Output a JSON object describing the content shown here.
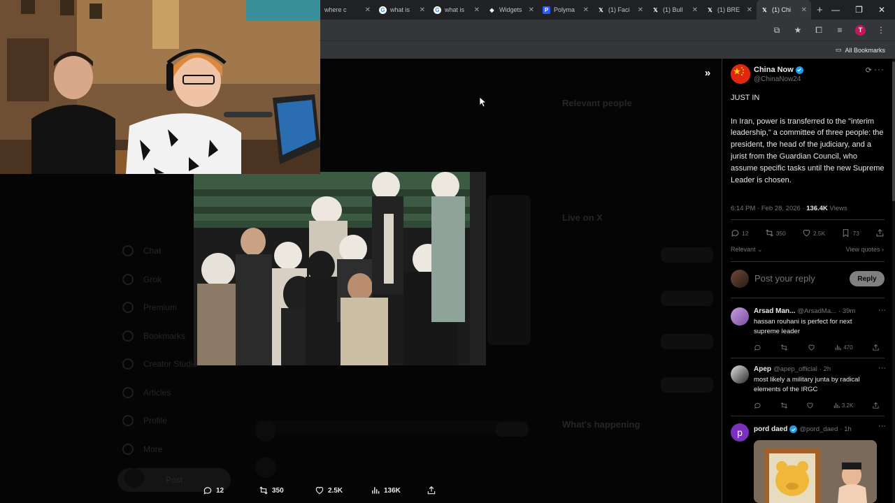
{
  "browser": {
    "tabs": [
      {
        "title": "where c",
        "favicon": "generic",
        "active": false
      },
      {
        "title": "what is",
        "favicon": "google",
        "active": false
      },
      {
        "title": "what is",
        "favicon": "google",
        "active": false
      },
      {
        "title": "Widgets",
        "favicon": "widget",
        "active": false
      },
      {
        "title": "Polyma",
        "favicon": "polymarket",
        "active": false
      },
      {
        "title": "(1) Faci",
        "favicon": "x",
        "active": false
      },
      {
        "title": "(1) Bull",
        "favicon": "x",
        "active": false
      },
      {
        "title": "(1) BRE",
        "favicon": "x",
        "active": false
      },
      {
        "title": "(1) Chi",
        "favicon": "x",
        "active": true
      }
    ],
    "profile_initial": "T",
    "bookmarks_label": "All Bookmarks"
  },
  "post": {
    "author_name": "China Now",
    "author_handle": "@ChinaNow24",
    "text": "JUST IN\n\nIn Iran, power is transferred to the \"interim leadership,\" a committee of three people: the president, the head of the judiciary, and a jurist from the Guardian Council, who assume specific tasks until the new Supreme Leader is chosen.",
    "timestamp": "6:14 PM · Feb 28, 2026 · ",
    "views_count": "136.4K",
    "views_label": "Views",
    "stats": {
      "replies": "12",
      "reposts": "350",
      "likes": "2.5K",
      "bookmarks": "73"
    },
    "sort_label": "Relevant",
    "view_quotes_label": "View quotes"
  },
  "reply_composer": {
    "placeholder": "Post your reply",
    "button_label": "Reply"
  },
  "replies": [
    {
      "name": "Arsad Man...",
      "handle": "@ArsadMa...",
      "time": "· 39m",
      "text": "hassan rouhani is perfect for next supreme leader",
      "views": "470"
    },
    {
      "name": "Apep",
      "handle": "@apep_official",
      "time": "· 2h",
      "text": "most likely a military junta by radical elements of the IRGC",
      "views": "3.2K"
    },
    {
      "name": "pord daed",
      "handle": "@pord_daed",
      "time": "· 1h",
      "text": "",
      "views": "",
      "avatar_letter": "p"
    }
  ],
  "media_bar": {
    "replies": "12",
    "reposts": "350",
    "likes": "2.5K",
    "views": "136K"
  },
  "background": {
    "nav_items": [
      "Chat",
      "Grok",
      "Premium",
      "Bookmarks",
      "Creator Studio",
      "Articles",
      "Profile",
      "More"
    ],
    "post_button": "Post",
    "right_headers": [
      "Relevant people",
      "Live on X",
      "What's happening"
    ]
  }
}
